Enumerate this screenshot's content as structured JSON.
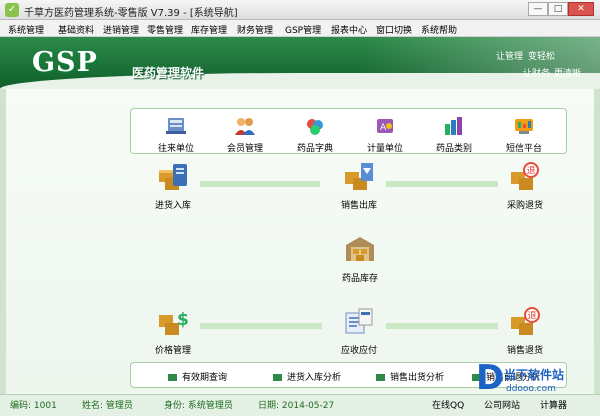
{
  "window": {
    "title": "千草方医药管理系统-零售版 V7.39 - [系统导航]",
    "controls": [
      "minimize",
      "maximize",
      "close"
    ]
  },
  "menu": [
    "系统管理",
    "基础资料",
    "进销管理",
    "零售管理",
    "库存管理",
    "财务管理",
    "GSP管理",
    "报表中心",
    "窗口切换",
    "系统帮助"
  ],
  "banner": {
    "logo": "GSP",
    "title": "医药管理软件",
    "links": [
      "让管理",
      "变轻松",
      "让财务",
      "更清晰"
    ]
  },
  "top_panel": [
    {
      "label": "往来单位",
      "icon": "contacts-icon"
    },
    {
      "label": "会员管理",
      "icon": "members-icon"
    },
    {
      "label": "药品字典",
      "icon": "medicine-dictionary-icon"
    },
    {
      "label": "计量单位",
      "icon": "units-icon"
    },
    {
      "label": "药品类别",
      "icon": "categories-icon"
    },
    {
      "label": "短信平台",
      "icon": "sms-icon"
    }
  ],
  "flow": {
    "purchase_in": "进货入库",
    "sales_out": "销售出库",
    "purchase_return": "采购退货",
    "stock": "药品库存",
    "price_mgmt": "价格管理",
    "receivable_payable": "应收应付",
    "sales_return": "销售退货"
  },
  "bottom_panel": [
    "有效期查询",
    "进货入库分析",
    "销售出货分析",
    "销售前退分析"
  ],
  "status": {
    "code_label": "编码:",
    "code": "1001",
    "name_label": "姓名:",
    "name": "管理员",
    "role_label": "身份:",
    "role": "系统管理员",
    "date_label": "日期:",
    "date": "2014-05-27",
    "online_qq": "在线QQ",
    "company_site": "公司网站",
    "calculator": "计算器"
  },
  "watermark": {
    "brand": "当下软件站",
    "url": "ddooo.com"
  },
  "colors": {
    "banner_green": "#1f7a3c",
    "panel_border": "#a6cfa6",
    "flow_bar": "#c9e8c3",
    "status_text": "#1c6b1c"
  }
}
